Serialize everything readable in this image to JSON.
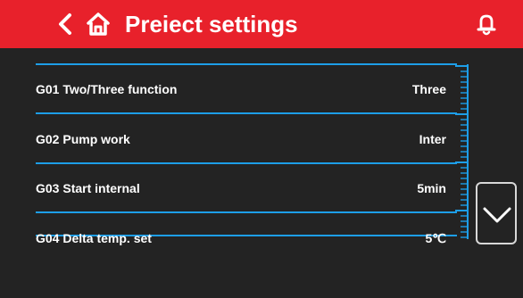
{
  "header": {
    "title": "Preiect settings",
    "back_icon": "chevron-left-icon",
    "home_icon": "home-icon",
    "alarm_icon": "bell-icon",
    "bar_color": "#e8212b"
  },
  "settings": {
    "items": [
      {
        "label": "G01 Two/Three function",
        "value": "Three"
      },
      {
        "label": "G02 Pump work",
        "value": "Inter"
      },
      {
        "label": "G03 Start internal",
        "value": "5min"
      },
      {
        "label": "G04 Delta temp. set",
        "value": "5℃"
      }
    ]
  },
  "scroll": {
    "down_icon": "chevron-down-icon"
  },
  "colors": {
    "background": "#232323",
    "accent": "#1d9ee8",
    "text": "#ffffff"
  }
}
